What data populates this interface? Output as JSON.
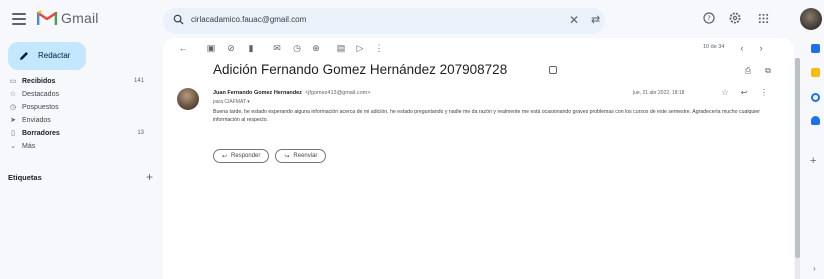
{
  "app": {
    "name": "Gmail"
  },
  "search": {
    "value": "cirlacadamico.fauac@gmail.com"
  },
  "compose": {
    "label": "Redactar"
  },
  "nav": {
    "items": [
      {
        "icon": "inbox-icon",
        "label": "Recibidos",
        "count": "141",
        "bold": true
      },
      {
        "icon": "star-icon",
        "label": "Destacados",
        "count": "",
        "bold": false
      },
      {
        "icon": "clock-icon",
        "label": "Pospuestos",
        "count": "",
        "bold": false
      },
      {
        "icon": "send-icon",
        "label": "Enviados",
        "count": "",
        "bold": false
      },
      {
        "icon": "draft-icon",
        "label": "Borradores",
        "count": "13",
        "bold": true
      },
      {
        "icon": "chevron-down-icon",
        "label": "Más",
        "count": "",
        "bold": false
      }
    ],
    "labels_title": "Etiquetas"
  },
  "toolbar": {
    "pager": "10 de 34"
  },
  "message": {
    "subject": "Adición Fernando Gomez Hernández 207908728",
    "sender_name": "Juan Fernando Gomez Hernandez",
    "sender_email": "<jfgomez413@gmail.com>",
    "to": "para CIAFMAT ▾",
    "date": "jue, 21 abr 2022, 18:18",
    "body": "Buena tarde, he estado esperando alguna información acerca de mi adición, he estado preguntando y nadie me da razón y realmente me está ocasionando graves problemas con los cursos de este semestre. Agradecería mucho cualquier información al respecto.",
    "reply_label": "Responder",
    "forward_label": "Reenviar"
  },
  "colors": {
    "compose_bg": "#c2e7ff",
    "search_bg": "#eaf1fb",
    "page_bg": "#f6f8fc",
    "gmail_red": "#ea4335"
  }
}
